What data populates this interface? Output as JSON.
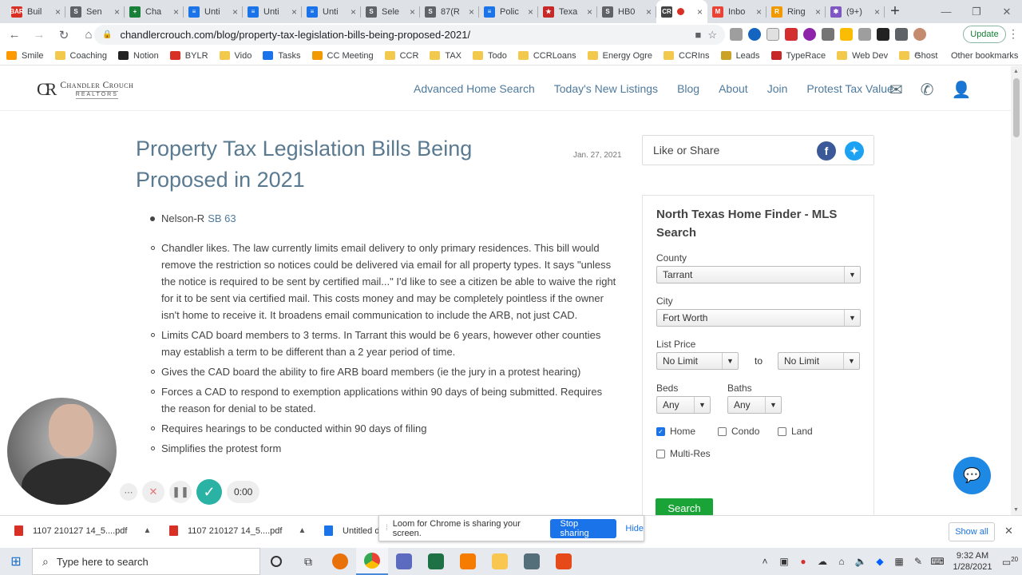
{
  "browser": {
    "tabs": [
      {
        "label": "Buil",
        "fav_color": "#d93025",
        "fav_text": "BAR"
      },
      {
        "label": "Sen",
        "fav_color": "#5f6368",
        "fav_text": "S"
      },
      {
        "label": "Cha",
        "fav_color": "#188038",
        "fav_text": "+"
      },
      {
        "label": "Unti",
        "fav_color": "#1a73e8",
        "fav_text": "≡"
      },
      {
        "label": "Unti",
        "fav_color": "#1a73e8",
        "fav_text": "≡"
      },
      {
        "label": "Unti",
        "fav_color": "#1a73e8",
        "fav_text": "≡"
      },
      {
        "label": "Sele",
        "fav_color": "#5f6368",
        "fav_text": "S"
      },
      {
        "label": "87(R",
        "fav_color": "#5f6368",
        "fav_text": "S"
      },
      {
        "label": "Polic",
        "fav_color": "#1a73e8",
        "fav_text": "≡"
      },
      {
        "label": "Texa",
        "fav_color": "#c62828",
        "fav_text": "★"
      },
      {
        "label": "HB0",
        "fav_color": "#5f6368",
        "fav_text": "S"
      },
      {
        "label": "",
        "fav_color": "#444444",
        "fav_text": "CR",
        "active": true
      },
      {
        "label": "Inbo",
        "fav_color": "#ea4335",
        "fav_text": "M"
      },
      {
        "label": "Ring",
        "fav_color": "#f29900",
        "fav_text": "R"
      },
      {
        "label": "(9+)",
        "fav_color": "#7e57c2",
        "fav_text": "✱"
      }
    ],
    "tab_close": "×",
    "new_tab": "+",
    "url": "chandlercrouch.com/blog/property-tax-legislation-bills-being-proposed-2021/",
    "update_label": "Update",
    "bookmarks": [
      {
        "label": "Smile",
        "color": "#ff9900"
      },
      {
        "label": "Coaching",
        "color": "#f2c94c"
      },
      {
        "label": "Notion",
        "color": "#222222"
      },
      {
        "label": "BYLR",
        "color": "#d93025"
      },
      {
        "label": "Vido",
        "color": "#f2c94c"
      },
      {
        "label": "Tasks",
        "color": "#1a73e8"
      },
      {
        "label": "CC Meeting",
        "color": "#f29900"
      },
      {
        "label": "CCR",
        "color": "#f2c94c"
      },
      {
        "label": "TAX",
        "color": "#f2c94c"
      },
      {
        "label": "Todo",
        "color": "#f2c94c"
      },
      {
        "label": "CCRLoans",
        "color": "#f2c94c"
      },
      {
        "label": "Energy Ogre",
        "color": "#f2c94c"
      },
      {
        "label": "CCRIns",
        "color": "#f2c94c"
      },
      {
        "label": "Leads",
        "color": "#c9a227"
      },
      {
        "label": "TypeRace",
        "color": "#c62828"
      },
      {
        "label": "Web Dev",
        "color": "#f2c94c"
      },
      {
        "label": "Ghost",
        "color": "#f2c94c"
      }
    ],
    "bookmarks_more": "»",
    "other_bookmarks": "Other bookmarks"
  },
  "site": {
    "logo_name": "Chandler Crouch",
    "logo_sub": "REALTORS",
    "nav": [
      "Advanced Home Search",
      "Today's New Listings",
      "Blog",
      "About",
      "Join",
      "Protest Tax Value"
    ]
  },
  "post": {
    "title": "Property Tax Legislation Bills Being Proposed in 2021",
    "date": "Jan. 27, 2021",
    "bill_author": "Nelson-R",
    "bill_link": "SB 63",
    "points": [
      "Chandler likes. The law currently limits email delivery to only primary residences. This bill would remove the restriction so notices could be delivered via email for all property types. It says \"unless the notice is required to be sent by certified mail...\" I'd like to see a citizen be able to waive the right for it to be sent via certified mail. This costs money and may be completely pointless if the owner isn't home to receive it. It broadens email communication to include the ARB, not just CAD.",
      "Limits CAD board members to 3 terms. In Tarrant this would be 6 years, however other counties may establish a term to be different than a 2 year period of time.",
      "Gives the CAD board the ability to fire ARB board members (ie the jury in a protest hearing)",
      "Forces a CAD to respond to exemption applications within 90 days of being submitted. Requires the reason for denial to be stated.",
      "Requires hearings to be conducted within 90 days of filing",
      "Simplifies the protest form"
    ]
  },
  "sidebar": {
    "share_label": "Like or Share",
    "finder_title": "North Texas Home Finder - MLS Search",
    "county_label": "County",
    "county_value": "Tarrant",
    "city_label": "City",
    "city_value": "Fort Worth",
    "price_label": "List Price",
    "price_min": "No Limit",
    "price_to": "to",
    "price_max": "No Limit",
    "beds_label": "Beds",
    "beds_value": "Any",
    "baths_label": "Baths",
    "baths_value": "Any",
    "types": [
      {
        "label": "Home",
        "checked": true
      },
      {
        "label": "Condo",
        "checked": false
      },
      {
        "label": "Land",
        "checked": false
      },
      {
        "label": "Multi-Res",
        "checked": false
      }
    ],
    "search_label": "Search"
  },
  "loom": {
    "timer": "0:00",
    "share_notice": "Loom for Chrome is sharing your screen.",
    "stop_label": "Stop sharing",
    "hide_label": "Hide"
  },
  "downloads": {
    "items": [
      "1107 210127 14_5....pdf",
      "1107 210127 14_5....pdf",
      "Untitled d"
    ],
    "show_all": "Show all"
  },
  "taskbar": {
    "search_placeholder": "Type here to search",
    "time": "9:32 AM",
    "date": "1/28/2021",
    "notifications": "20"
  }
}
